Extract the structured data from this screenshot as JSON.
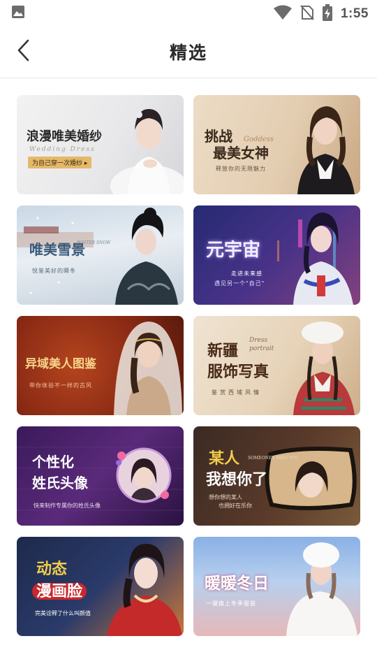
{
  "status_bar": {
    "time": "1:55"
  },
  "header": {
    "title": "精选"
  },
  "cards": [
    {
      "title": "浪漫唯美婚纱",
      "en": "Wedding Dress",
      "sub": "为自己穿一次婚纱 ▸"
    },
    {
      "title1": "挑战",
      "title2": "最美女神",
      "en": "Goddess",
      "sub": "释放你的无限魅力"
    },
    {
      "title": "唯美雪景",
      "en": "POSTER SNOW",
      "sub": "悦鉴美好的瞬冬"
    },
    {
      "title": "元宇宙",
      "sub1": "走进未来感",
      "sub2": "遇见另一个\"自己\""
    },
    {
      "title": "异域美人图鉴",
      "sub": "带你体验不一样的古风"
    },
    {
      "title1": "新疆",
      "title2": "服饰写真",
      "en1": "Dress",
      "en2": "portrait",
      "sub": "鉴赏西域风情"
    },
    {
      "title1": "个性化",
      "title2": "姓氏头像",
      "sub": "快来制作专属你的姓氏头像"
    },
    {
      "title1": "某人",
      "title2": "我想你了",
      "en": "SOMEONE I MISS YOU",
      "sub1": "想你想的某人",
      "sub2": "也拥好在乐你"
    },
    {
      "title1": "动态",
      "title2": "漫画脸",
      "sub": "完美诠释了什么叫颜值"
    },
    {
      "title": "暖暖冬日",
      "sub": "一键换上冬季服装"
    }
  ]
}
